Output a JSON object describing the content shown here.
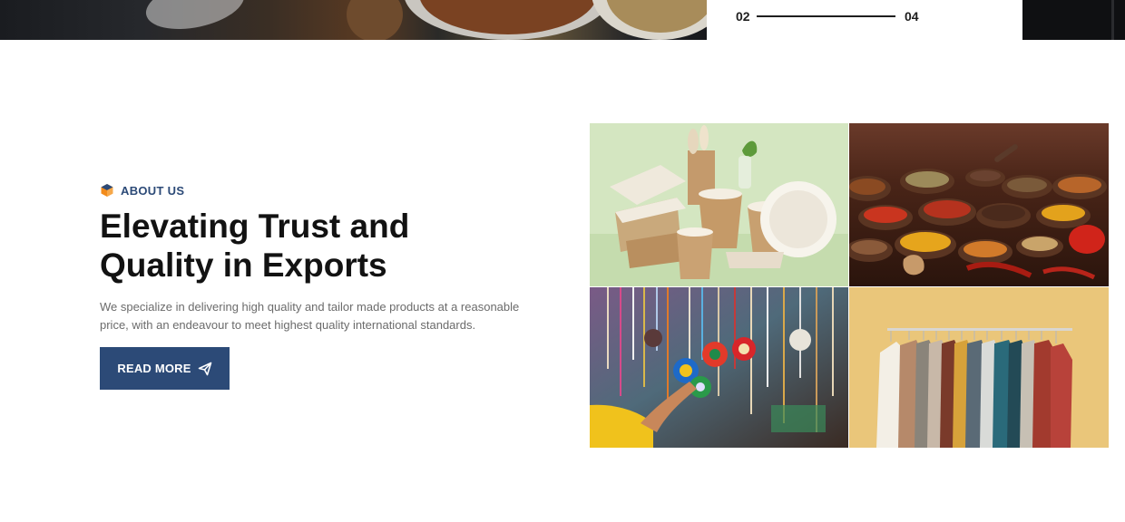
{
  "slider": {
    "current": "02",
    "total": "04"
  },
  "about": {
    "badge_icon": "cube-logo-icon",
    "badge_label": "ABOUT US",
    "title_line1": "Elevating Trust and",
    "title_line2": "Quality in Exports",
    "description": "We specialize in delivering high quality and tailor made products at a reasonable price, with an endeavour to meet highest quality international standards.",
    "button_label": "READ MORE",
    "button_icon": "paper-plane-icon"
  },
  "colors": {
    "accent": "#2c4a77",
    "badge_orange": "#f28b1b",
    "heading": "#121212",
    "body_text": "#6b6b6b"
  }
}
